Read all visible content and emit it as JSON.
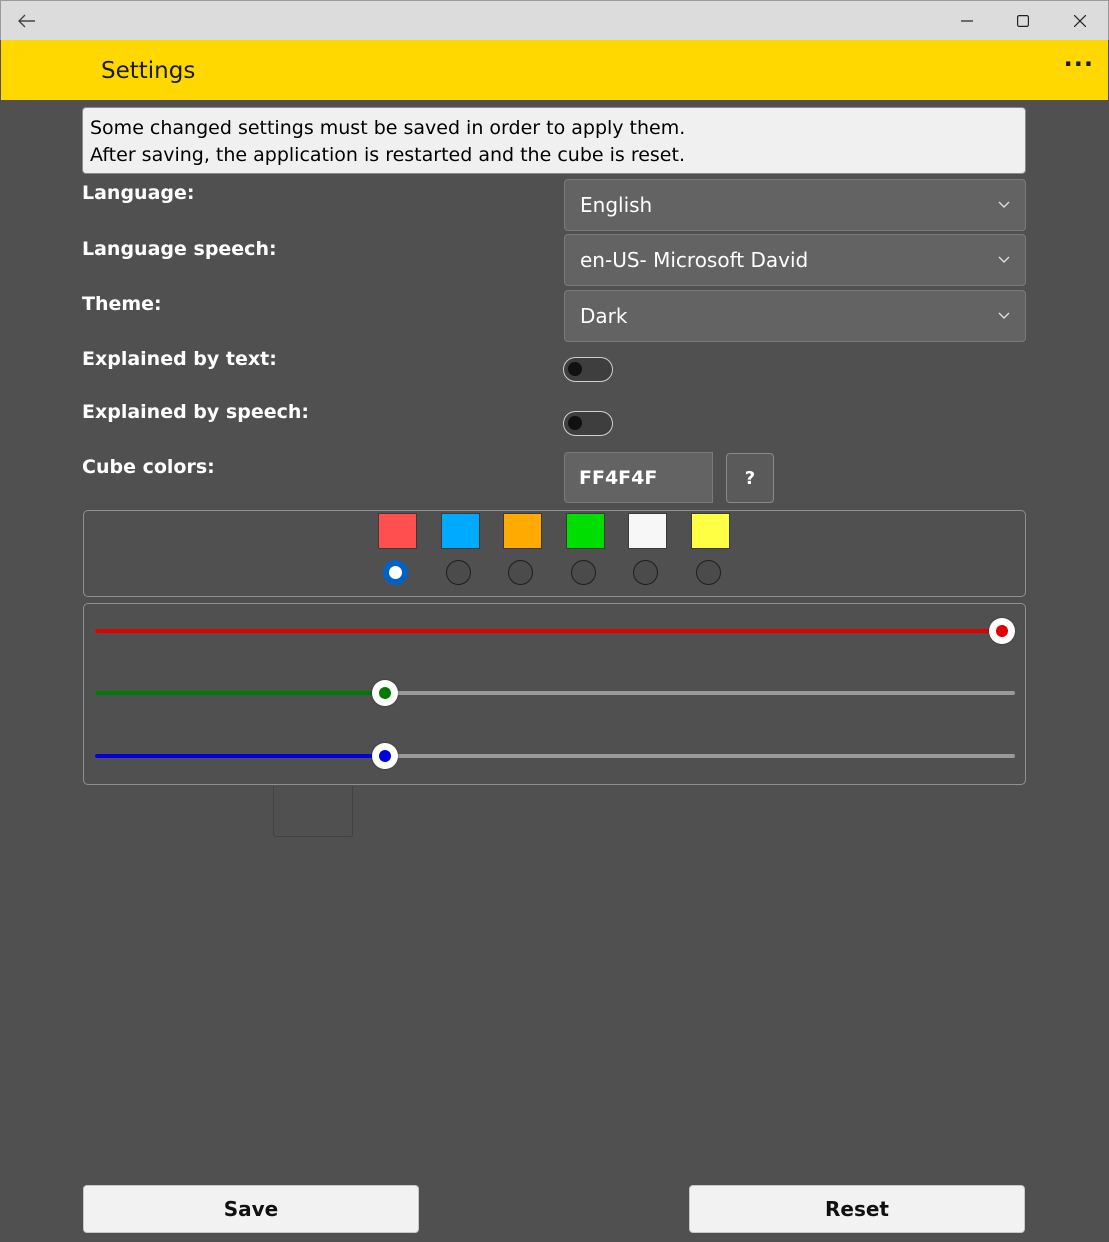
{
  "window": {
    "controls": {
      "back": "←",
      "minimize": "—",
      "maximize": "☐",
      "close": "✕"
    }
  },
  "appbar": {
    "title": "Settings",
    "more": "···",
    "color": "#ffd800"
  },
  "notice": {
    "line1": "Some changed settings must be saved in order to apply them.",
    "line2": "After saving, the application is restarted and the cube is reset."
  },
  "settings": {
    "language_label": "Language:",
    "language_value": "English",
    "speech_label": "Language speech:",
    "speech_value": "en-US- Microsoft David",
    "theme_label": "Theme:",
    "theme_value": "Dark",
    "explained_text_label": "Explained by text:",
    "explained_text_on": false,
    "explained_speech_label": "Explained by speech:",
    "explained_speech_on": false,
    "cube_colors_label": "Cube colors:",
    "hex_value": "FF4F4F",
    "help_label": "?"
  },
  "cube_colors": {
    "swatches": [
      "#ff4f4f",
      "#00aaff",
      "#ffaa00",
      "#00dd00",
      "#f7f7f7",
      "#ffff44"
    ],
    "selected_index": 0
  },
  "rgb_sliders": {
    "red": {
      "value": 255,
      "max": 255,
      "color": "#e00000"
    },
    "green": {
      "value": 79,
      "max": 255,
      "color": "#007a00"
    },
    "blue": {
      "value": 79,
      "max": 255,
      "color": "#0000e0"
    }
  },
  "buttons": {
    "save": "Save",
    "reset": "Reset"
  }
}
